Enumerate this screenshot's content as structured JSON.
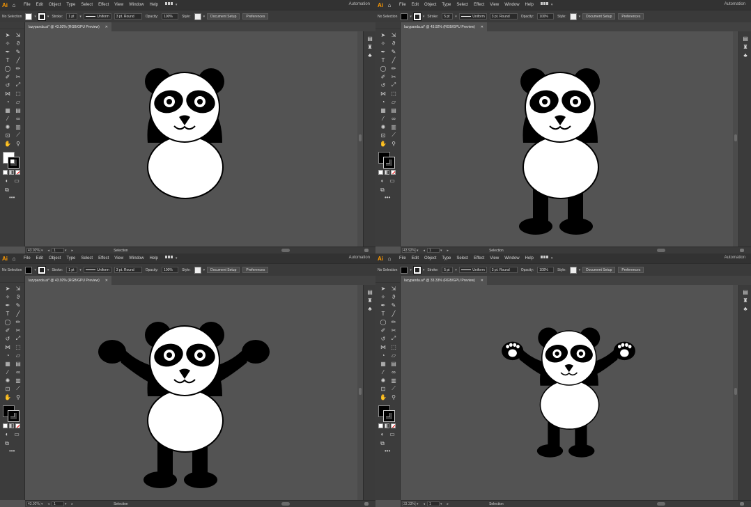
{
  "app": {
    "logo": "Ai",
    "home_icon": "home-icon",
    "menus": [
      "File",
      "Edit",
      "Object",
      "Type",
      "Select",
      "Effect",
      "View",
      "Window",
      "Help"
    ],
    "workspace": "Automation"
  },
  "control_bar": {
    "no_selection": "No Selection",
    "stroke_label": "Stroke:",
    "stroke_weight": "1 pt",
    "stroke_weight_alt": "5 pt",
    "profile": "Uniform",
    "brush": "3 pt. Round",
    "opacity_label": "Opacity:",
    "opacity_value": "100%",
    "style_label": "Style:",
    "document_setup": "Document Setup",
    "preferences": "Preferences"
  },
  "panels": [
    {
      "tab_title": "lazypanda.ai* @ 43.92% (RGB/GPU Preview)",
      "zoom": "43.92%",
      "artboard": "1",
      "status": "Selection",
      "fill": "white",
      "stroke_weight": "1 pt",
      "stage": "body"
    },
    {
      "tab_title": "lazypanda.ai* @ 43.92% (RGB/GPU Preview)",
      "zoom": "43.92%",
      "artboard": "1",
      "status": "Selection",
      "fill": "black",
      "stroke_weight": "5 pt",
      "stage": "legs"
    },
    {
      "tab_title": "lazypanda.ai* @ 43.92% (RGB/GPU Preview)",
      "zoom": "43.92%",
      "artboard": "1",
      "status": "Selection",
      "fill": "black",
      "stroke_weight": "1 pt",
      "stage": "arms"
    },
    {
      "tab_title": "lazypanda.ai* @ 33.33% (RGB/GPU Preview)",
      "zoom": "33.33%",
      "artboard": "1",
      "status": "Selection",
      "fill": "black",
      "stroke_weight": "5 pt",
      "stage": "paws"
    }
  ],
  "colors": {
    "canvas": "#535353",
    "chrome_dark": "#323232",
    "chrome": "#3a3a3a",
    "ai_orange": "#ff9a00",
    "panda_black": "#000000",
    "panda_white": "#ffffff"
  },
  "tools": [
    "selection-tool-icon",
    "direct-selection-tool-icon",
    "magic-wand-icon",
    "lasso-icon",
    "pen-tool-icon",
    "curvature-tool-icon",
    "type-tool-icon",
    "line-tool-icon",
    "ellipse-tool-icon",
    "paintbrush-icon",
    "shaper-icon",
    "eraser-icon",
    "rotate-icon",
    "scale-icon",
    "width-tool-icon",
    "free-transform-icon",
    "shape-builder-icon",
    "perspective-icon",
    "mesh-icon",
    "gradient-icon",
    "eyedropper-icon",
    "blend-icon",
    "symbol-sprayer-icon",
    "column-graph-icon",
    "artboard-tool-icon",
    "slice-icon",
    "hand-tool-icon",
    "zoom-tool-icon"
  ]
}
